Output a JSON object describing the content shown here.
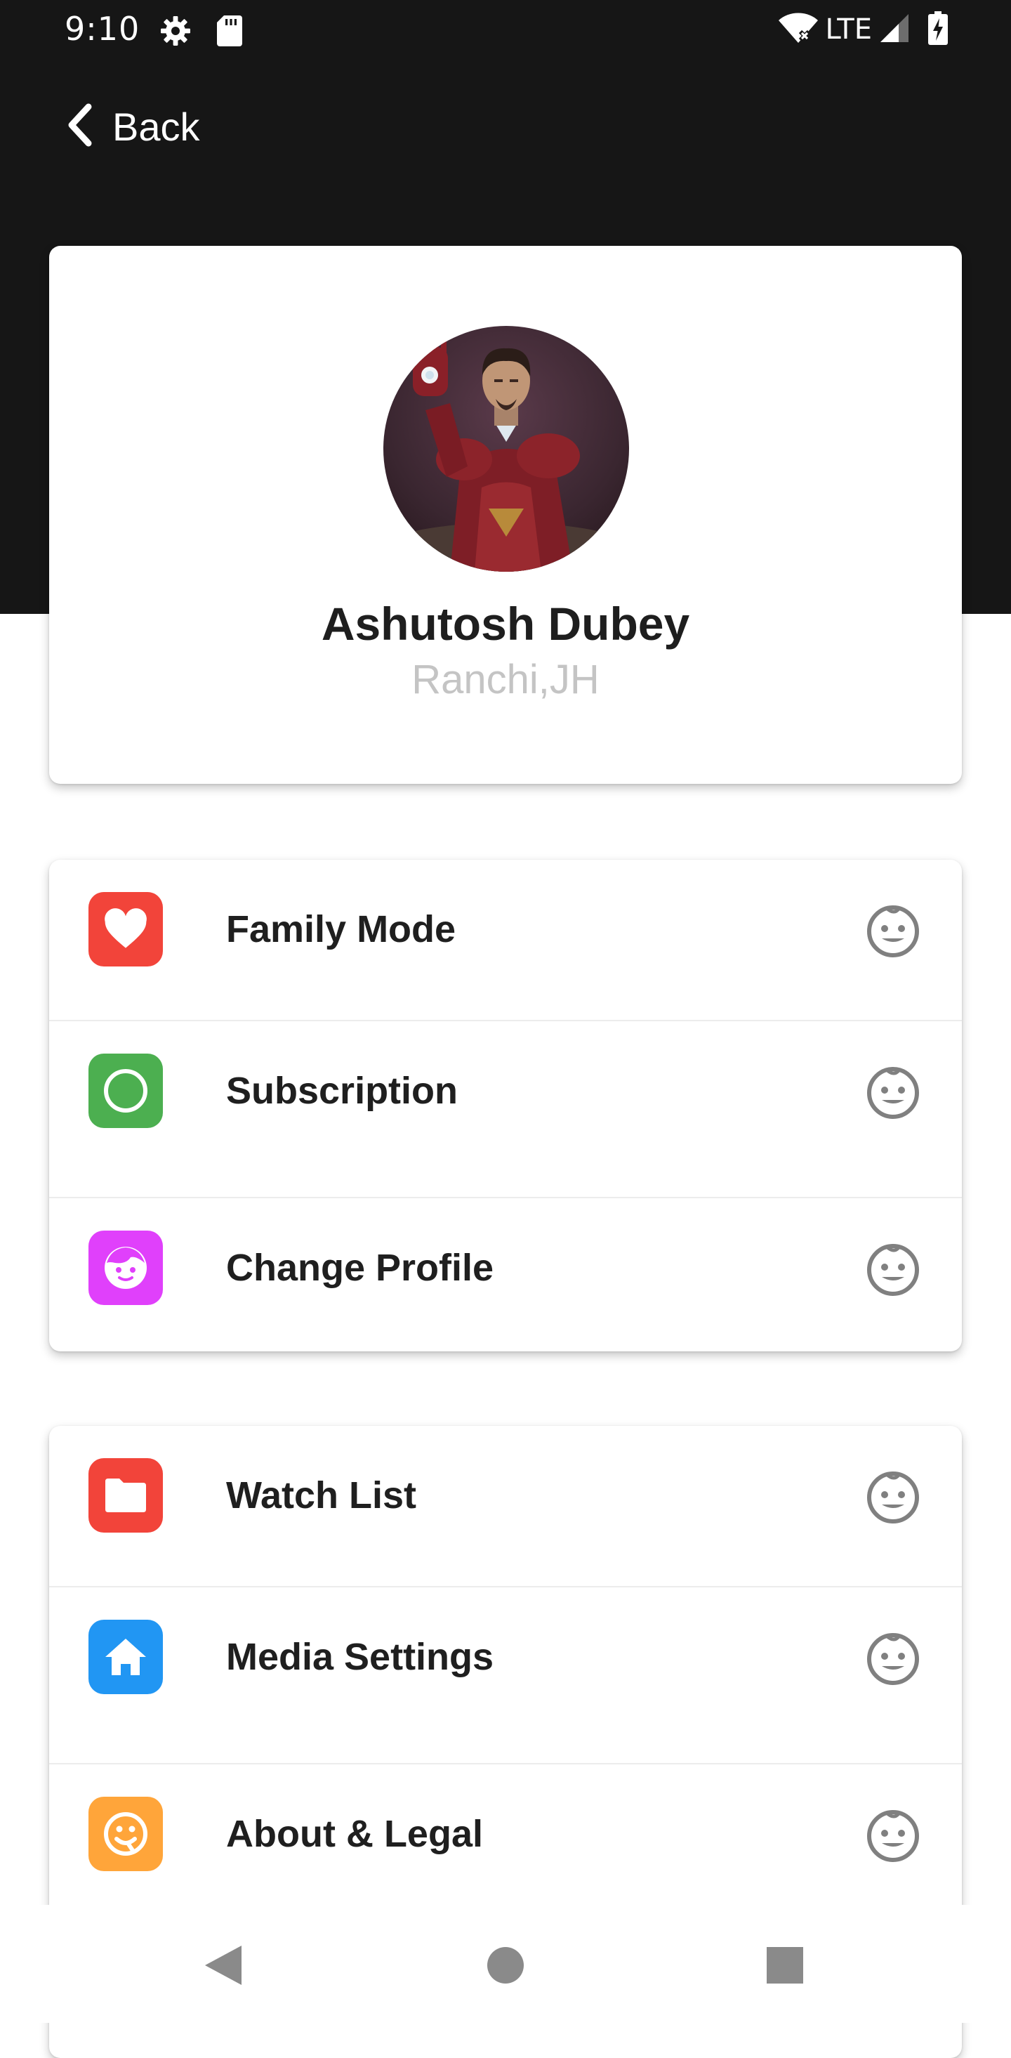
{
  "status_bar": {
    "time": "9:10",
    "network": "LTE",
    "icons": [
      "settings-icon",
      "sd-card-icon",
      "wifi-icon",
      "signal-icon",
      "battery-charging-icon"
    ]
  },
  "header": {
    "back_label": "Back",
    "background_color": "#161616"
  },
  "profile": {
    "name": "Ashutosh Dubey",
    "location": "Ranchi,JH"
  },
  "menu_group_1": [
    {
      "label": "Family Mode",
      "icon": "heart-icon",
      "color": "#f2443a"
    },
    {
      "label": "Subscription",
      "icon": "circle-icon",
      "color": "#4caf50"
    },
    {
      "label": "Change Profile",
      "icon": "face-icon",
      "color": "#e040fb"
    }
  ],
  "menu_group_2": [
    {
      "label": "Watch List",
      "icon": "folder-icon",
      "color": "#f2443a"
    },
    {
      "label": "Media Settings",
      "icon": "home-icon",
      "color": "#2196f3"
    },
    {
      "label": "About & Legal",
      "icon": "smile-badge-icon",
      "color": "#ffa53a"
    }
  ],
  "trailing_icon": "baby-face-icon",
  "nav": {
    "buttons": [
      "back-triangle",
      "home-circle",
      "recents-square"
    ]
  }
}
